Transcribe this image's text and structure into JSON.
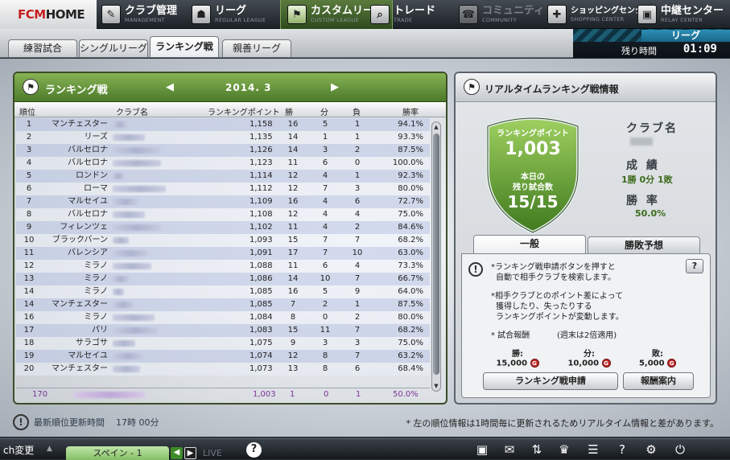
{
  "logo": {
    "prefix": "FCM",
    "suffix": "HOME"
  },
  "nav": [
    {
      "ja": "クラブ管理",
      "en": "MANAGEMENT",
      "icon": "club-management-icon",
      "glyph": "✎"
    },
    {
      "ja": "リーグ",
      "en": "REGULAR LEAGUE",
      "icon": "player-icon",
      "glyph": "☗"
    },
    {
      "ja": "カスタムリーグ",
      "en": "CUSTOM LEAGUE",
      "icon": "flag-icon",
      "glyph": "⚑"
    },
    {
      "ja": "トレード",
      "en": "TRADE",
      "icon": "search-icon",
      "glyph": "⌕"
    },
    {
      "ja": "コミュニティ",
      "en": "COMMUNITY",
      "icon": "community-icon",
      "glyph": "☎"
    },
    {
      "ja": "ショッピングセンター",
      "en": "SHOPPING CENTER",
      "icon": "gift-icon",
      "glyph": "✚"
    },
    {
      "ja": "中継センター",
      "en": "RELAY CENTER",
      "icon": "broadcast-icon",
      "glyph": "▣"
    }
  ],
  "subtabs": [
    "練習試合",
    "シングルリーグ",
    "ランキング戦",
    "親善リーグ"
  ],
  "league_box": {
    "label": "リーグ",
    "remaining_label": "残り時間",
    "remaining_time": "01:09"
  },
  "ranking": {
    "title": "ランキング戦",
    "month": "2014. 3",
    "prev": "◀",
    "next": "▶",
    "columns": [
      "順位",
      "クラブ名",
      "ランキングポイント",
      "勝",
      "分",
      "負",
      "勝率"
    ],
    "rows": [
      {
        "rank": "1",
        "city": "マンチェスター",
        "points": "1,158",
        "w": "16",
        "d": "5",
        "l": "1",
        "rate": "94.1%"
      },
      {
        "rank": "2",
        "city": "リーズ",
        "points": "1,135",
        "w": "14",
        "d": "1",
        "l": "1",
        "rate": "93.3%"
      },
      {
        "rank": "3",
        "city": "バルセロナ",
        "points": "1,126",
        "w": "14",
        "d": "3",
        "l": "2",
        "rate": "87.5%"
      },
      {
        "rank": "4",
        "city": "バルセロナ",
        "points": "1,123",
        "w": "11",
        "d": "6",
        "l": "0",
        "rate": "100.0%"
      },
      {
        "rank": "5",
        "city": "ロンドン",
        "points": "1,114",
        "w": "12",
        "d": "4",
        "l": "1",
        "rate": "92.3%"
      },
      {
        "rank": "6",
        "city": "ローマ",
        "points": "1,112",
        "w": "12",
        "d": "7",
        "l": "3",
        "rate": "80.0%"
      },
      {
        "rank": "7",
        "city": "マルセイユ",
        "points": "1,109",
        "w": "16",
        "d": "4",
        "l": "6",
        "rate": "72.7%"
      },
      {
        "rank": "8",
        "city": "バルセロナ",
        "points": "1,108",
        "w": "12",
        "d": "4",
        "l": "4",
        "rate": "75.0%"
      },
      {
        "rank": "9",
        "city": "フィレンツェ",
        "points": "1,102",
        "w": "11",
        "d": "4",
        "l": "2",
        "rate": "84.6%"
      },
      {
        "rank": "10",
        "city": "ブラックバーン",
        "points": "1,093",
        "w": "15",
        "d": "7",
        "l": "7",
        "rate": "68.2%"
      },
      {
        "rank": "11",
        "city": "バレンシア",
        "points": "1,091",
        "w": "17",
        "d": "7",
        "l": "10",
        "rate": "63.0%"
      },
      {
        "rank": "12",
        "city": "ミラノ",
        "points": "1,088",
        "w": "11",
        "d": "6",
        "l": "4",
        "rate": "73.3%"
      },
      {
        "rank": "13",
        "city": "ミラノ",
        "points": "1,086",
        "w": "14",
        "d": "10",
        "l": "7",
        "rate": "66.7%"
      },
      {
        "rank": "14",
        "city": "ミラノ",
        "points": "1,085",
        "w": "16",
        "d": "5",
        "l": "9",
        "rate": "64.0%"
      },
      {
        "rank": "14",
        "city": "マンチェスター",
        "points": "1,085",
        "w": "7",
        "d": "2",
        "l": "1",
        "rate": "87.5%"
      },
      {
        "rank": "16",
        "city": "ミラノ",
        "points": "1,084",
        "w": "8",
        "d": "0",
        "l": "2",
        "rate": "80.0%"
      },
      {
        "rank": "17",
        "city": "パリ",
        "points": "1,083",
        "w": "15",
        "d": "11",
        "l": "7",
        "rate": "68.2%"
      },
      {
        "rank": "18",
        "city": "サラゴサ",
        "points": "1,075",
        "w": "9",
        "d": "3",
        "l": "3",
        "rate": "75.0%"
      },
      {
        "rank": "19",
        "city": "マルセイユ",
        "points": "1,074",
        "w": "12",
        "d": "8",
        "l": "7",
        "rate": "63.2%"
      },
      {
        "rank": "20",
        "city": "マンチェスター",
        "points": "1,073",
        "w": "13",
        "d": "8",
        "l": "6",
        "rate": "68.4%"
      }
    ],
    "my_row": {
      "rank": "170",
      "points": "1,003",
      "w": "1",
      "d": "0",
      "l": "1",
      "rate": "50.0%"
    }
  },
  "realtime": {
    "title": "リアルタイムランキング戦情報",
    "points_label": "ランキングポイント",
    "points_value": "1,003",
    "remaining_label_1": "本日の",
    "remaining_label_2": "残り試合数",
    "remaining_value": "15/15",
    "club_label": "クラブ名",
    "record_label": "成 績",
    "record_value": "1勝 0分 1敗",
    "rate_label": "勝 率",
    "rate_value": "50.0%",
    "tabs": [
      "一般",
      "勝敗予想"
    ],
    "info_1": "*ランキング戦申請ボタンを押すと",
    "info_2": "自動で相手クラブを検索します。",
    "info_3": "*相手クラブとのポイント差によって",
    "info_4": "獲得したり、失ったりする",
    "info_5": "ランキングポイントが変動します。",
    "reward_title": "* 試合報酬",
    "reward_note": "(週末は2倍適用)",
    "rewards": [
      {
        "label": "勝:",
        "value": "15,000"
      },
      {
        "label": "分:",
        "value": "10,000"
      },
      {
        "label": "敗:",
        "value": "5,000"
      }
    ],
    "coin_glyph": "G",
    "apply_button": "ランキング戦申請",
    "reward_info_button": "報酬案内",
    "help_glyph": "?"
  },
  "footer": {
    "update_label": "最新順位更新時間",
    "update_time": "17時 00分",
    "note": "* 左の順位情報は1時間毎に更新されるためリアルタイム情報と差があります。"
  },
  "bottombar": {
    "channel": "ch変更",
    "league_select": "スペイン - 1",
    "live": "LIVE",
    "help": "?"
  },
  "colors": {
    "accent_green": "#4c7a2a",
    "purple_row": "#7a3596",
    "coin_red": "#c22a2a"
  }
}
